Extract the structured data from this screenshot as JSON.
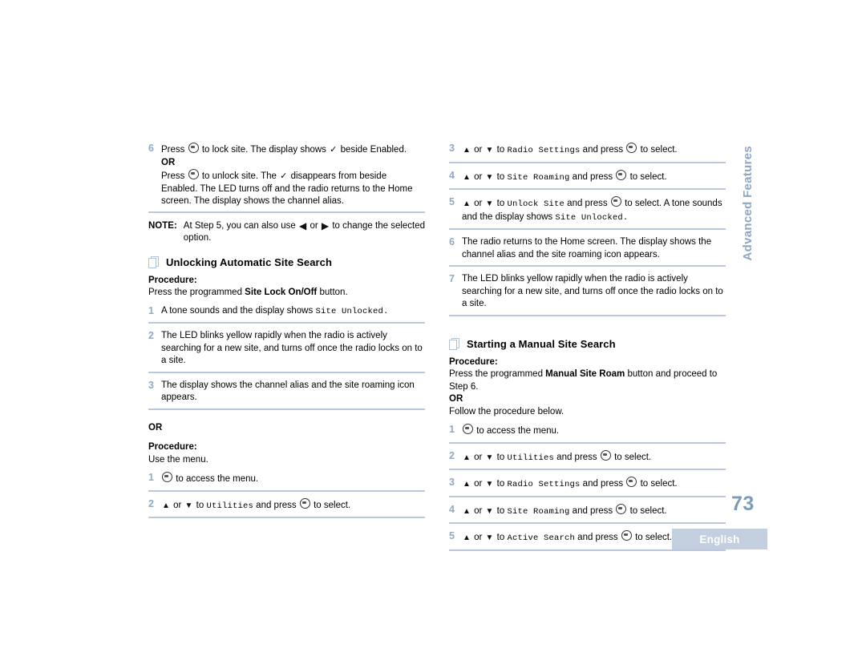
{
  "page": {
    "number": "73",
    "language_badge": "English",
    "side_tab": "Advanced Features",
    "colors": {
      "accent_blue": "#8fa8c6",
      "rule_blue": "#bcc6dd",
      "page_num_blue": "#7d9ab8",
      "badge_bg": "#c3cfdf",
      "badge_text": "#ffffff"
    }
  },
  "left_column": {
    "step6": {
      "num": "6",
      "line1_a": "Press",
      "line1_b": "to lock site. The display shows",
      "line1_c": "beside Enabled.",
      "or": "OR",
      "line2_a": "Press",
      "line2_b": "to unlock site. The",
      "line2_c": "disappears from beside Enabled. The LED turns off and the radio returns to the Home screen. The display shows the channel alias."
    },
    "note": {
      "label": "NOTE:",
      "text_a": "At Step 5, you can also use",
      "text_b": "or",
      "text_c": "to change the selected option."
    },
    "heading": "Unlocking Automatic Site Search",
    "procedure_label_1": "Procedure:",
    "procedure_intro_1_a": "Press the programmed",
    "procedure_intro_1_bold": "Site Lock On/Off",
    "procedure_intro_1_b": "button.",
    "steps_a": [
      {
        "num": "1",
        "text_a": "A tone sounds and the display shows",
        "mono": "Site Unlocked.",
        "text_b": ""
      },
      {
        "num": "2",
        "text_a": "The LED blinks yellow rapidly when the radio is actively searching for a new site, and turns off once the radio locks on to a site.",
        "mono": "",
        "text_b": ""
      },
      {
        "num": "3",
        "text_a": "The display shows the channel alias and the site roaming icon appears.",
        "mono": "",
        "text_b": ""
      }
    ],
    "or": "OR",
    "procedure_label_2": "Procedure:",
    "procedure_intro_2": "Use the menu.",
    "steps_b": [
      {
        "num": "1",
        "pre": "",
        "text_a": "to access the menu.",
        "mono": "",
        "text_b": ""
      },
      {
        "num": "2",
        "pre": "arrows",
        "text_a": "to",
        "mono": "Utilities",
        "text_b": "and press",
        "text_c": "to select."
      }
    ]
  },
  "right_column": {
    "steps_top": [
      {
        "num": "3",
        "text_a": "to",
        "mono": "Radio Settings",
        "text_b": "and press",
        "text_c": "to select.",
        "tail": ""
      },
      {
        "num": "4",
        "text_a": "to",
        "mono": "Site Roaming",
        "text_b": "and press",
        "text_c": "to select.",
        "tail": ""
      },
      {
        "num": "5",
        "text_a": "to",
        "mono": "Unlock Site",
        "text_b": "and press",
        "text_c": "to select. A tone sounds and the display shows",
        "mono2": "Site Unlocked.",
        "tail": ""
      },
      {
        "num": "6",
        "plain": "The radio returns to the Home screen. The display shows the channel alias and the site roaming icon appears."
      },
      {
        "num": "7",
        "plain": "The LED blinks yellow rapidly when the radio is actively searching for a new site, and turns off once the radio locks on to a site."
      }
    ],
    "heading": "Starting a Manual Site Search",
    "procedure_label": "Procedure:",
    "procedure_intro_a": "Press the programmed",
    "procedure_intro_bold": "Manual Site Roam",
    "procedure_intro_b": "button and proceed to Step 6.",
    "or": "OR",
    "procedure_follow": "Follow the procedure below.",
    "steps_bottom": [
      {
        "num": "1",
        "pre": "",
        "text_a": "to access the menu.",
        "mono": "",
        "text_b": "",
        "text_c": ""
      },
      {
        "num": "2",
        "pre": "arrows",
        "text_a": "to",
        "mono": "Utilities",
        "text_b": "and press",
        "text_c": "to select."
      },
      {
        "num": "3",
        "pre": "arrows",
        "text_a": "to",
        "mono": "Radio Settings",
        "text_b": "and press",
        "text_c": "to select."
      },
      {
        "num": "4",
        "pre": "arrows",
        "text_a": "to",
        "mono": "Site Roaming",
        "text_b": "and press",
        "text_c": "to select."
      },
      {
        "num": "5",
        "pre": "arrows",
        "text_a": "to",
        "mono": "Active Search",
        "text_b": "and press",
        "text_c": "to select."
      }
    ]
  },
  "glyphs": {
    "menu_button": "menu-ok-button",
    "up_arrow": "▲",
    "down_arrow": "▼",
    "left_arrow": "◀",
    "right_arrow": "▶",
    "check": "✓",
    "or_word": "or"
  }
}
